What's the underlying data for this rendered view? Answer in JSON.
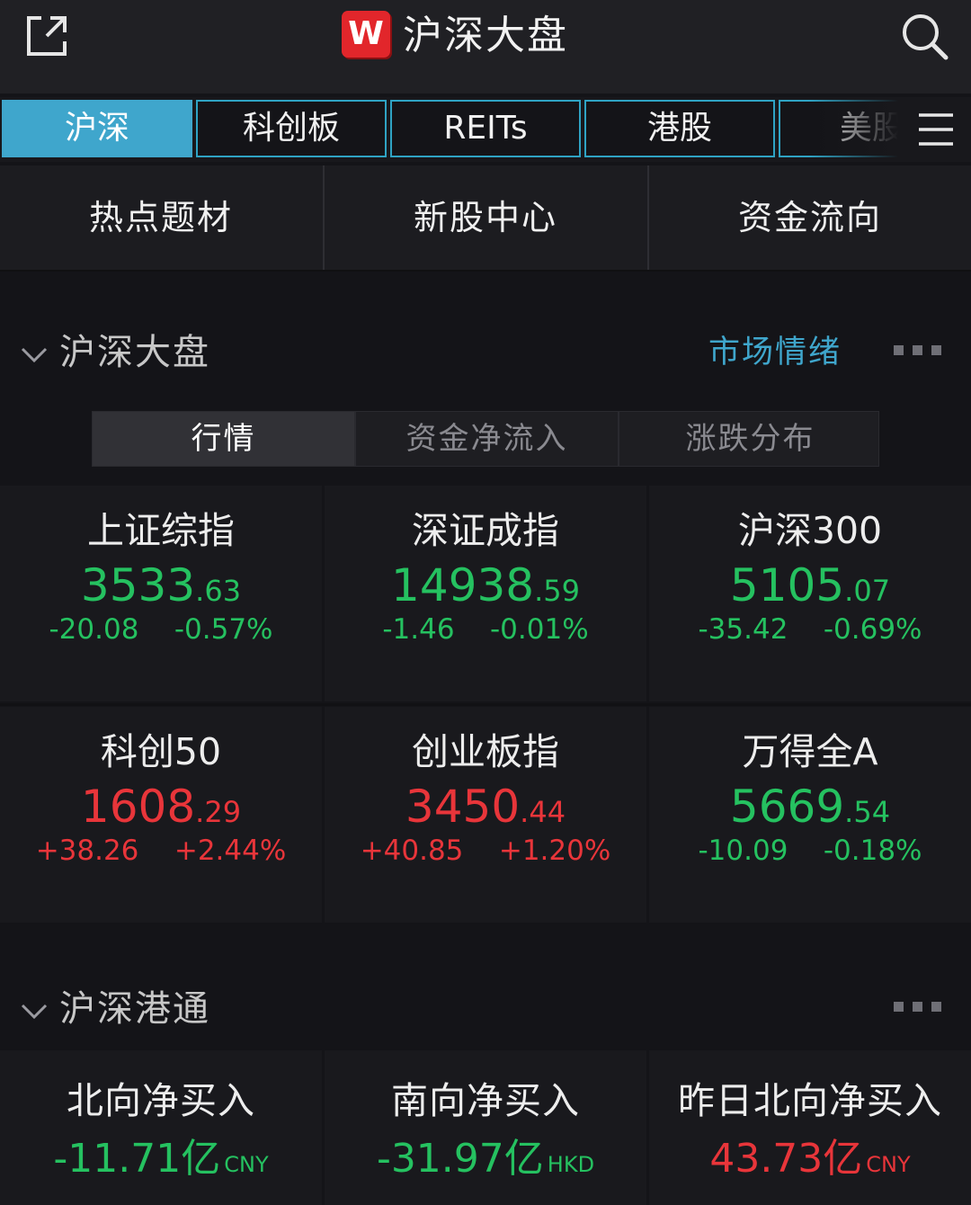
{
  "header": {
    "logo_letter": "W",
    "title": "沪深大盘",
    "icons": [
      "external-link-icon",
      "search-icon"
    ]
  },
  "tabs": {
    "items": [
      {
        "label": "沪深",
        "active": true
      },
      {
        "label": "科创板",
        "active": false
      },
      {
        "label": "REITs",
        "active": false
      },
      {
        "label": "港股",
        "active": false
      },
      {
        "label": "美股",
        "active": false
      }
    ],
    "menu_icon": "hamburger-menu-icon"
  },
  "features": [
    {
      "label": "热点题材"
    },
    {
      "label": "新股中心"
    },
    {
      "label": "资金流向"
    }
  ],
  "market_section": {
    "title": "沪深大盘",
    "link": "市场情绪",
    "segments": [
      {
        "label": "行情",
        "active": true
      },
      {
        "label": "资金净流入",
        "active": false
      },
      {
        "label": "涨跌分布",
        "active": false
      }
    ],
    "indices": [
      {
        "name": "上证综指",
        "price_int": "3533",
        "price_dec": ".63",
        "change": "-20.08",
        "pct": "-0.57%",
        "trend": "down"
      },
      {
        "name": "深证成指",
        "price_int": "14938",
        "price_dec": ".59",
        "change": "-1.46",
        "pct": "-0.01%",
        "trend": "down"
      },
      {
        "name": "沪深300",
        "price_int": "5105",
        "price_dec": ".07",
        "change": "-35.42",
        "pct": "-0.69%",
        "trend": "down"
      },
      {
        "name": "科创50",
        "price_int": "1608",
        "price_dec": ".29",
        "change": "+38.26",
        "pct": "+2.44%",
        "trend": "up"
      },
      {
        "name": "创业板指",
        "price_int": "3450",
        "price_dec": ".44",
        "change": "+40.85",
        "pct": "+1.20%",
        "trend": "up"
      },
      {
        "name": "万得全A",
        "price_int": "5669",
        "price_dec": ".54",
        "change": "-10.09",
        "pct": "-0.18%",
        "trend": "down"
      }
    ]
  },
  "connect_section": {
    "title": "沪深港通",
    "items": [
      {
        "name": "北向净买入",
        "value": "-11.71亿",
        "currency": "CNY",
        "trend": "down"
      },
      {
        "name": "南向净买入",
        "value": "-31.97亿",
        "currency": "HKD",
        "trend": "down"
      },
      {
        "name": "昨日北向净买入",
        "value": "43.73亿",
        "currency": "CNY",
        "trend": "up"
      }
    ]
  },
  "colors": {
    "up": "#e8353a",
    "down": "#25c160",
    "accent": "#3fa6cc",
    "background": "#141418"
  }
}
